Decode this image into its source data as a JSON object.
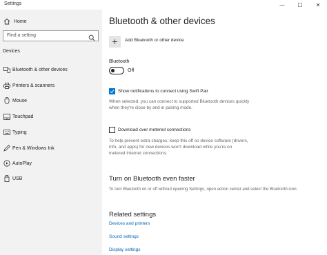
{
  "window": {
    "title": "Settings",
    "minimize_glyph": "—",
    "maximize_glyph": "☐",
    "close_glyph": "✕"
  },
  "sidebar": {
    "home_label": "Home",
    "search_placeholder": "Find a setting",
    "section_label": "Devices",
    "items": [
      {
        "label": "Bluetooth & other devices",
        "icon": "bluetooth-devices-icon"
      },
      {
        "label": "Printers & scanners",
        "icon": "printer-icon"
      },
      {
        "label": "Mouse",
        "icon": "mouse-icon"
      },
      {
        "label": "Touchpad",
        "icon": "touchpad-icon"
      },
      {
        "label": "Typing",
        "icon": "keyboard-icon"
      },
      {
        "label": "Pen & Windows Ink",
        "icon": "pen-icon"
      },
      {
        "label": "AutoPlay",
        "icon": "autoplay-icon"
      },
      {
        "label": "USB",
        "icon": "usb-icon"
      }
    ]
  },
  "main": {
    "title": "Bluetooth & other devices",
    "add_label": "Add Bluetooth or other device",
    "bluetooth_label": "Bluetooth",
    "bluetooth_state": "Off",
    "swift_pair": {
      "label": "Show notifications to connect using Swift Pair",
      "checked": true,
      "desc_line1": "When selected, you can connect to supported Bluetooth devices quickly",
      "desc_line2": "when they're close by and in pairing mode."
    },
    "metered": {
      "label": "Download over metered connections",
      "checked": false,
      "desc_line1": "To help prevent extra charges, keep this off so device software (drivers,",
      "desc_line2": "info, and apps) for new devices won't download while you're on",
      "desc_line3": "metered Internet connections."
    },
    "faster": {
      "heading": "Turn on Bluetooth even faster",
      "desc": "To turn Bluetooth on or off without opening Settings, open action center and select the Bluetooth icon."
    },
    "related": {
      "heading": "Related settings",
      "links": [
        "Devices and printers",
        "Sound settings",
        "Display settings"
      ]
    }
  },
  "colors": {
    "accent": "#0078d7",
    "link": "#0067b8",
    "sidebar_bg": "#f2f2f2"
  }
}
